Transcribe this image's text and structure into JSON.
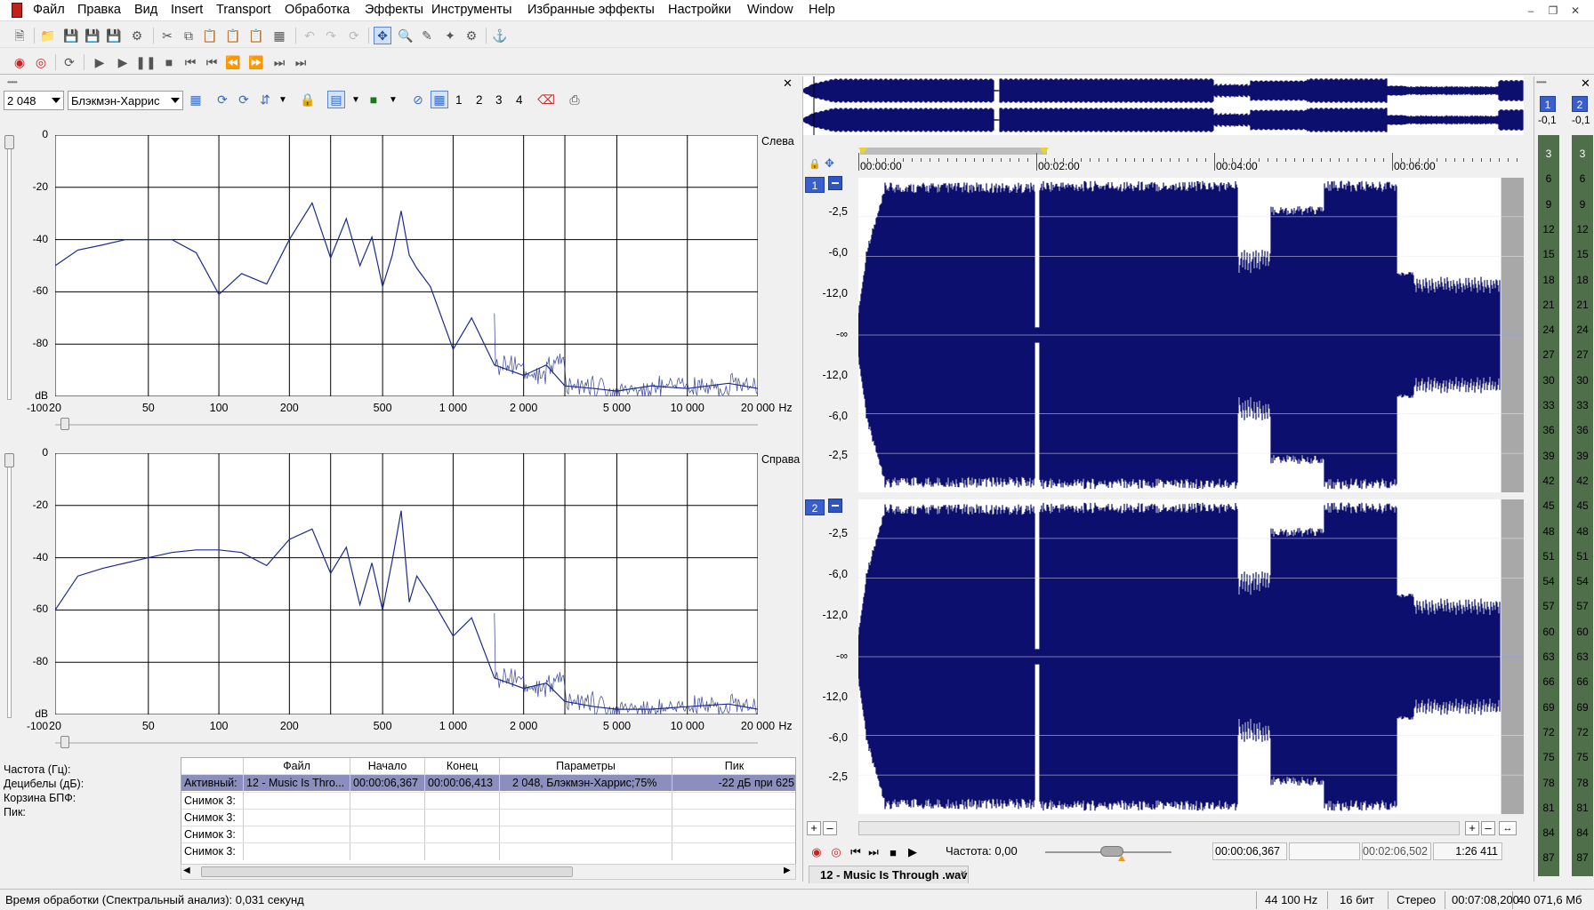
{
  "menu": [
    "Файл",
    "Правка",
    "Вид",
    "Insert",
    "Transport",
    "Обработка",
    "Эффекты",
    "Инструменты",
    "Избранные эффекты",
    "Настройки",
    "Window",
    "Help"
  ],
  "analysis": {
    "fft_size": "2 048",
    "window": "Блэкмэн-Харрис",
    "snapshot_numbers": [
      "1",
      "2",
      "3",
      "4"
    ]
  },
  "graphs": {
    "left_label": "Слева",
    "right_label": "Справа",
    "y_ticks": [
      "0",
      "-20",
      "-40",
      "-60",
      "-80",
      "dB -100"
    ],
    "x_ticks": [
      "20",
      "50",
      "100",
      "200",
      "500",
      "1 000",
      "2 000",
      "5 000",
      "10 000",
      "20 000"
    ],
    "x_unit": "Hz"
  },
  "chart_data": {
    "type": "line",
    "xlabel": "Hz",
    "ylabel": "dB",
    "ylim": [
      -100,
      0
    ],
    "x_scale": "log",
    "x_range": [
      20,
      20000
    ],
    "grid": true,
    "series": [
      {
        "name": "Слева",
        "x": [
          20,
          25,
          32,
          40,
          50,
          63,
          80,
          100,
          125,
          160,
          200,
          250,
          300,
          350,
          400,
          450,
          500,
          550,
          600,
          650,
          700,
          800,
          1000,
          1200,
          1500,
          2000,
          2500,
          3000,
          4000,
          5000,
          7000,
          10000,
          15000,
          20000
        ],
        "y": [
          -50,
          -44,
          -42,
          -40,
          -40,
          -40,
          -45,
          -61,
          -53,
          -57,
          -40,
          -26,
          -47,
          -32,
          -50,
          -39,
          -58,
          -46,
          -29,
          -46,
          -51,
          -58,
          -82,
          -70,
          -88,
          -92,
          -88,
          -96,
          -97,
          -98,
          -96,
          -97,
          -95,
          -97
        ]
      },
      {
        "name": "Справа",
        "x": [
          20,
          25,
          32,
          40,
          50,
          63,
          80,
          100,
          125,
          160,
          200,
          250,
          300,
          350,
          400,
          450,
          500,
          550,
          600,
          650,
          700,
          800,
          1000,
          1200,
          1500,
          2000,
          2500,
          3000,
          4000,
          5000,
          7000,
          10000,
          15000,
          20000
        ],
        "y": [
          -60,
          -47,
          -44,
          -42,
          -40,
          -38,
          -37,
          -37,
          -38,
          -43,
          -33,
          -29,
          -46,
          -36,
          -58,
          -42,
          -60,
          -41,
          -22,
          -57,
          -47,
          -55,
          -70,
          -63,
          -86,
          -90,
          -88,
          -95,
          -97,
          -98,
          -98,
          -97,
          -96,
          -98
        ]
      }
    ]
  },
  "info": {
    "freq": "Частота (Гц):",
    "db": "Децибелы (дБ):",
    "bin": "Корзина БПФ:",
    "peak": "Пик:"
  },
  "table": {
    "headers": [
      "Файл",
      "Начало",
      "Конец",
      "Параметры",
      "Пик"
    ],
    "active": {
      "label": "Активный:",
      "file": "12 - Music Is Thro...",
      "start": "00:00:06,367",
      "end": "00:00:06,413",
      "params": "2 048, Блэкмэн-Харрис;75%",
      "peak": "-22 дБ при 625"
    },
    "snap_label": "Снимок 3:"
  },
  "timeline": {
    "ticks": [
      "00:00:00",
      "00:02:00",
      "00:04:00",
      "00:06:00"
    ],
    "db_labels": [
      "-2,5",
      "-6,0",
      "-12,0",
      "-∞",
      "-12,0",
      "-6,0",
      "-2,5"
    ],
    "track1": "1",
    "track2": "2"
  },
  "transport": {
    "rate_label": "Частота: 0,00",
    "cursor": "00:00:06,367",
    "sel_end": "00:02:06,502",
    "zoom": "1:26 411",
    "file_tab": "12 - Music Is Through .wav"
  },
  "meter": {
    "top_values": [
      "-0,1",
      "-0,1"
    ],
    "channels": [
      "1",
      "2"
    ],
    "scale": [
      "3",
      "6",
      "9",
      "12",
      "15",
      "18",
      "21",
      "24",
      "27",
      "30",
      "33",
      "36",
      "39",
      "42",
      "45",
      "48",
      "51",
      "54",
      "57",
      "60",
      "63",
      "66",
      "69",
      "72",
      "75",
      "78",
      "81",
      "84",
      "87"
    ]
  },
  "status": {
    "left": "Время обработки (Спектральный анализ): 0,031 секунд",
    "rate": "44 100 Hz",
    "bits": "16 бит",
    "channels": "Стерео",
    "length": "00:07:08,200",
    "size": "40 071,6 Мб"
  },
  "colors": {
    "wave": "#0c0f6e",
    "accent": "#3a5fcd",
    "meter": "#4f6e4a"
  }
}
